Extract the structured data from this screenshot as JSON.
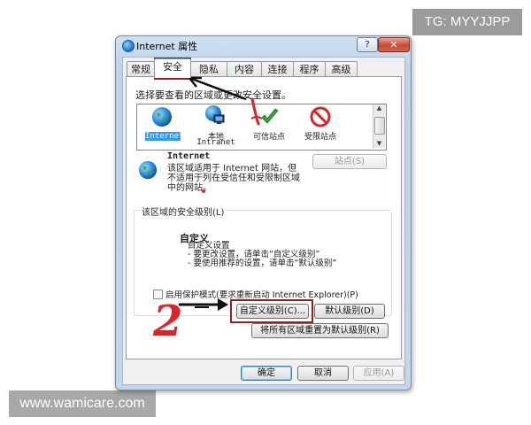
{
  "watermarks": {
    "top_right": "TG: MYYJJPP",
    "bottom_left": "www.wamicare.com"
  },
  "dialog": {
    "title": "Internet 属性",
    "help_glyph": "?",
    "close_glyph": "✕",
    "tabs": [
      {
        "label": "常规",
        "active": false
      },
      {
        "label": "安全",
        "active": true
      },
      {
        "label": "隐私",
        "active": false
      },
      {
        "label": "内容",
        "active": false
      },
      {
        "label": "连接",
        "active": false
      },
      {
        "label": "程序",
        "active": false
      },
      {
        "label": "高级",
        "active": false
      }
    ]
  },
  "security": {
    "prompt": "选择要查看的区域或更改安全设置。",
    "zones": [
      {
        "label": "Internet",
        "selected": true,
        "icon": "globe-icon"
      },
      {
        "label": "本地",
        "label2": "Intranet",
        "selected": false,
        "icon": "intranet-icon"
      },
      {
        "label": "可信站点",
        "selected": false,
        "icon": "checkmark-icon"
      },
      {
        "label": "受限站点",
        "selected": false,
        "icon": "restricted-icon"
      }
    ],
    "zone_name": "Internet",
    "zone_desc": [
      "该区域适用于 Internet 网站，但",
      "不适用于列在受信任和受限制区域",
      "中的网站。"
    ],
    "sites_button": "站点(S)",
    "level_group_label": "该区域的安全级别(L)",
    "level_title": "自定义",
    "level_lines": [
      "自定义设置",
      "- 要更改设置，请单击“自定义级别”",
      "- 要使用推荐的设置，请单击“默认级别”"
    ],
    "protected_mode_label": "启用保护模式(要求重新启动 Internet Explorer)(P)",
    "protected_mode_checked": false,
    "custom_level_button": "自定义级别(C)...",
    "default_level_button": "默认级别(D)",
    "reset_all_button": "将所有区域重置为默认级别(R)"
  },
  "footer": {
    "ok": "确定",
    "cancel": "取消",
    "apply": "应用(A)"
  },
  "annotations": {
    "number_2": "2",
    "accent_red": "#d8262b",
    "box_color": "#9b1c22"
  }
}
